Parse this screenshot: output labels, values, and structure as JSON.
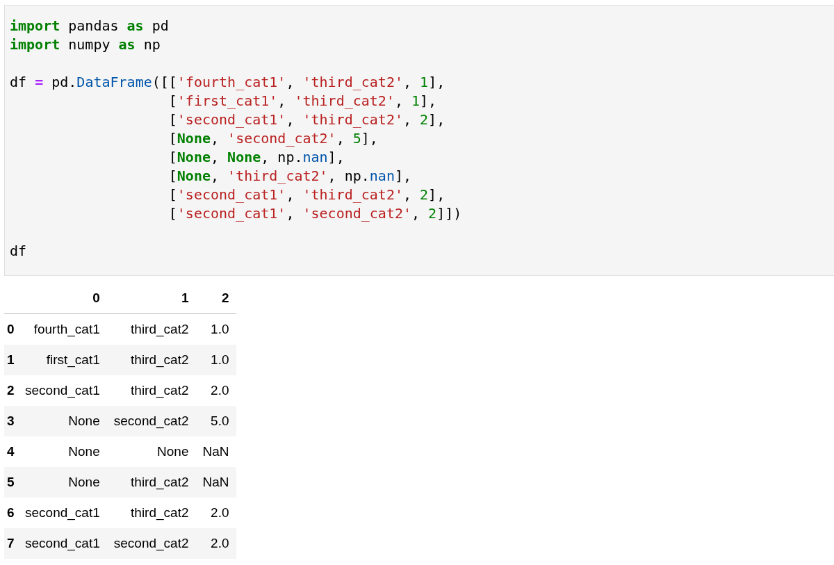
{
  "code_cell": {
    "blocks": [
      [
        [
          {
            "kind": "kw",
            "text": "import"
          },
          {
            "kind": "plain",
            "text": " pandas "
          },
          {
            "kind": "kw",
            "text": "as"
          },
          {
            "kind": "plain",
            "text": " pd"
          }
        ],
        [
          {
            "kind": "kw",
            "text": "import"
          },
          {
            "kind": "plain",
            "text": " numpy "
          },
          {
            "kind": "kw",
            "text": "as"
          },
          {
            "kind": "plain",
            "text": " np"
          }
        ]
      ],
      [
        [
          {
            "kind": "plain",
            "text": "df "
          },
          {
            "kind": "op",
            "text": "="
          },
          {
            "kind": "plain",
            "text": " pd."
          },
          {
            "kind": "name",
            "text": "DataFrame"
          },
          {
            "kind": "plain",
            "text": "([["
          },
          {
            "kind": "str",
            "text": "'fourth_cat1'"
          },
          {
            "kind": "plain",
            "text": ", "
          },
          {
            "kind": "str",
            "text": "'third_cat2'"
          },
          {
            "kind": "plain",
            "text": ", "
          },
          {
            "kind": "num",
            "text": "1"
          },
          {
            "kind": "plain",
            "text": "],"
          }
        ],
        [
          {
            "kind": "plain",
            "text": "                   ["
          },
          {
            "kind": "str",
            "text": "'first_cat1'"
          },
          {
            "kind": "plain",
            "text": ", "
          },
          {
            "kind": "str",
            "text": "'third_cat2'"
          },
          {
            "kind": "plain",
            "text": ", "
          },
          {
            "kind": "num",
            "text": "1"
          },
          {
            "kind": "plain",
            "text": "],"
          }
        ],
        [
          {
            "kind": "plain",
            "text": "                   ["
          },
          {
            "kind": "str",
            "text": "'second_cat1'"
          },
          {
            "kind": "plain",
            "text": ", "
          },
          {
            "kind": "str",
            "text": "'third_cat2'"
          },
          {
            "kind": "plain",
            "text": ", "
          },
          {
            "kind": "num",
            "text": "2"
          },
          {
            "kind": "plain",
            "text": "],"
          }
        ],
        [
          {
            "kind": "plain",
            "text": "                   ["
          },
          {
            "kind": "kw",
            "text": "None"
          },
          {
            "kind": "plain",
            "text": ", "
          },
          {
            "kind": "str",
            "text": "'second_cat2'"
          },
          {
            "kind": "plain",
            "text": ", "
          },
          {
            "kind": "num",
            "text": "5"
          },
          {
            "kind": "plain",
            "text": "],"
          }
        ],
        [
          {
            "kind": "plain",
            "text": "                   ["
          },
          {
            "kind": "kw",
            "text": "None"
          },
          {
            "kind": "plain",
            "text": ", "
          },
          {
            "kind": "kw",
            "text": "None"
          },
          {
            "kind": "plain",
            "text": ", np."
          },
          {
            "kind": "name",
            "text": "nan"
          },
          {
            "kind": "plain",
            "text": "],"
          }
        ],
        [
          {
            "kind": "plain",
            "text": "                   ["
          },
          {
            "kind": "kw",
            "text": "None"
          },
          {
            "kind": "plain",
            "text": ", "
          },
          {
            "kind": "str",
            "text": "'third_cat2'"
          },
          {
            "kind": "plain",
            "text": ", np."
          },
          {
            "kind": "name",
            "text": "nan"
          },
          {
            "kind": "plain",
            "text": "],"
          }
        ],
        [
          {
            "kind": "plain",
            "text": "                   ["
          },
          {
            "kind": "str",
            "text": "'second_cat1'"
          },
          {
            "kind": "plain",
            "text": ", "
          },
          {
            "kind": "str",
            "text": "'third_cat2'"
          },
          {
            "kind": "plain",
            "text": ", "
          },
          {
            "kind": "num",
            "text": "2"
          },
          {
            "kind": "plain",
            "text": "],"
          }
        ],
        [
          {
            "kind": "plain",
            "text": "                   ["
          },
          {
            "kind": "str",
            "text": "'second_cat1'"
          },
          {
            "kind": "plain",
            "text": ", "
          },
          {
            "kind": "str",
            "text": "'second_cat2'"
          },
          {
            "kind": "plain",
            "text": ", "
          },
          {
            "kind": "num",
            "text": "2"
          },
          {
            "kind": "plain",
            "text": "]])"
          }
        ]
      ],
      [
        [
          {
            "kind": "plain",
            "text": "df"
          }
        ]
      ]
    ]
  },
  "table": {
    "columns": [
      "",
      "0",
      "1",
      "2"
    ],
    "rows": [
      [
        "0",
        "fourth_cat1",
        "third_cat2",
        "1.0"
      ],
      [
        "1",
        "first_cat1",
        "third_cat2",
        "1.0"
      ],
      [
        "2",
        "second_cat1",
        "third_cat2",
        "2.0"
      ],
      [
        "3",
        "None",
        "second_cat2",
        "5.0"
      ],
      [
        "4",
        "None",
        "None",
        "NaN"
      ],
      [
        "5",
        "None",
        "third_cat2",
        "NaN"
      ],
      [
        "6",
        "second_cat1",
        "third_cat2",
        "2.0"
      ],
      [
        "7",
        "second_cat1",
        "second_cat2",
        "2.0"
      ]
    ]
  }
}
